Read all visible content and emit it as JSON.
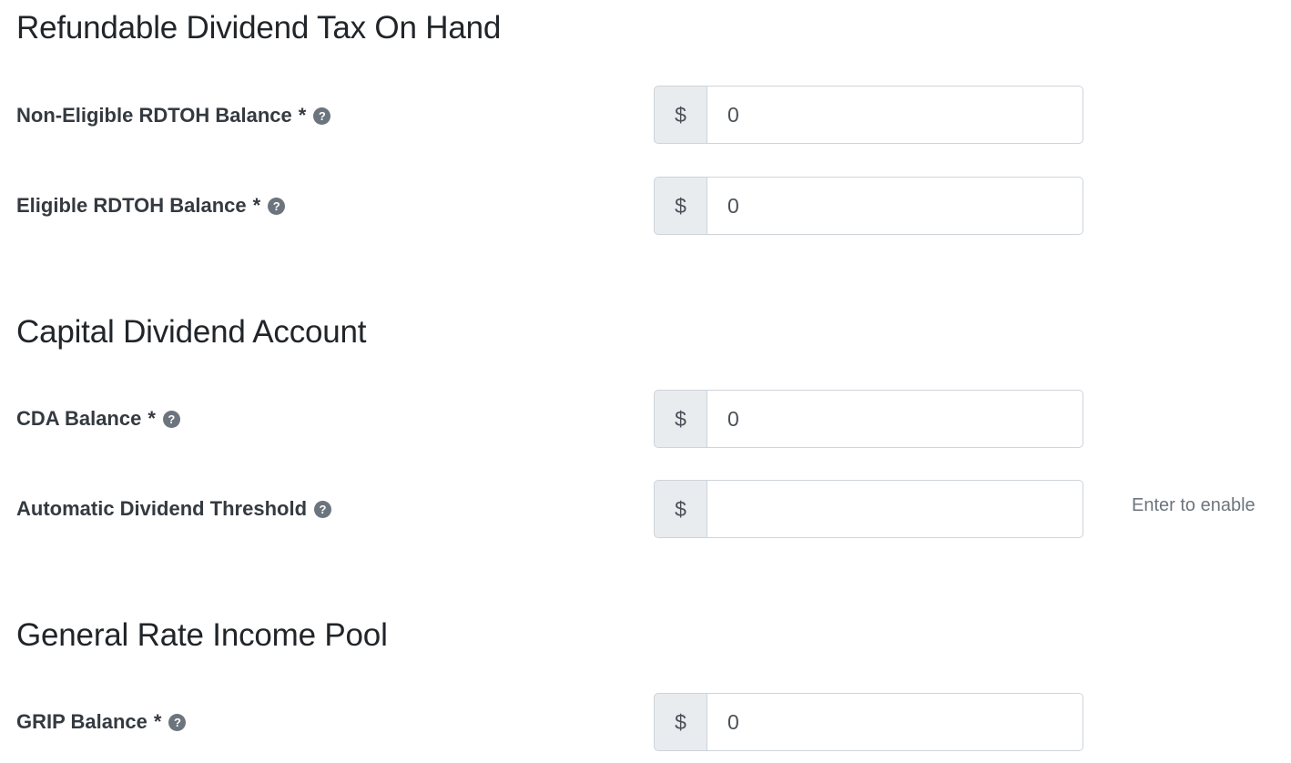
{
  "sections": {
    "rdtoh": {
      "title": "Refundable Dividend Tax On Hand",
      "fields": {
        "non_eligible": {
          "label": "Non-Eligible RDTOH Balance",
          "required_mark": "*",
          "help_icon": "question-circle-icon",
          "prefix": "$",
          "value": "0"
        },
        "eligible": {
          "label": "Eligible RDTOH Balance",
          "required_mark": "*",
          "help_icon": "question-circle-icon",
          "prefix": "$",
          "value": "0"
        }
      }
    },
    "cda": {
      "title": "Capital Dividend Account",
      "fields": {
        "cda_balance": {
          "label": "CDA Balance",
          "required_mark": "*",
          "help_icon": "question-circle-icon",
          "prefix": "$",
          "value": "0"
        },
        "auto_threshold": {
          "label": "Automatic Dividend Threshold",
          "help_icon": "question-circle-icon",
          "prefix": "$",
          "value": "",
          "hint": "Enter to enable"
        }
      }
    },
    "grip": {
      "title": "General Rate Income Pool",
      "fields": {
        "grip_balance": {
          "label": "GRIP Balance",
          "required_mark": "*",
          "help_icon": "question-circle-icon",
          "prefix": "$",
          "value": "0"
        }
      }
    }
  },
  "colors": {
    "heading": "#212529",
    "label": "#343a40",
    "prefix_bg": "#e9ecef",
    "border": "#ced4da",
    "help_icon": "#6c757d",
    "hint": "#6c757d"
  }
}
